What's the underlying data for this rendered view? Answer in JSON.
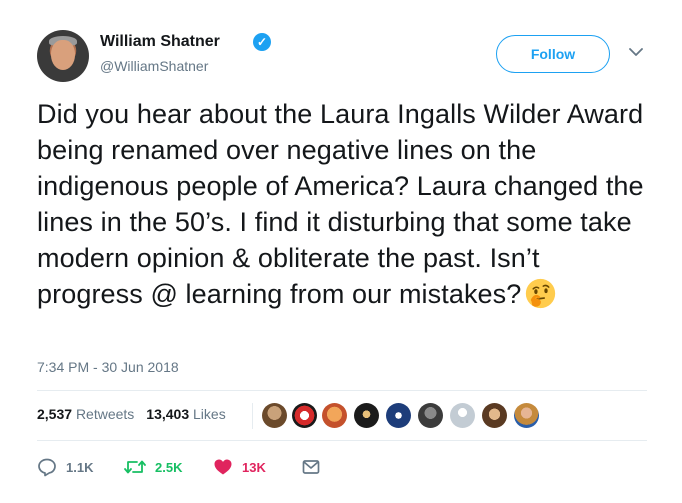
{
  "author": {
    "name": "William Shatner",
    "handle": "@WilliamShatner",
    "verified_icon": "verified-badge-icon"
  },
  "follow_label": "Follow",
  "tweet_text": "Did you hear about the Laura Ingalls Wilder Award being renamed over negative lines on the indigenous people of America? Laura changed the lines in the 50’s. I find it disturbing that some take modern opinion & obliterate the past.  Isn’t progress @ learning from our mistakes?",
  "emoji": "thinking-face-emoji",
  "timestamp": "7:34 PM - 30 Jun 2018",
  "stats": {
    "retweets_count": "2,537",
    "retweets_label": "Retweets",
    "likes_count": "13,403",
    "likes_label": "Likes"
  },
  "actions": {
    "replies": "1.1K",
    "retweets": "2.5K",
    "likes": "13K"
  },
  "colors": {
    "accent": "#1da1f2",
    "retweet": "#17bf63",
    "like": "#e0245e",
    "muted": "#657786"
  }
}
